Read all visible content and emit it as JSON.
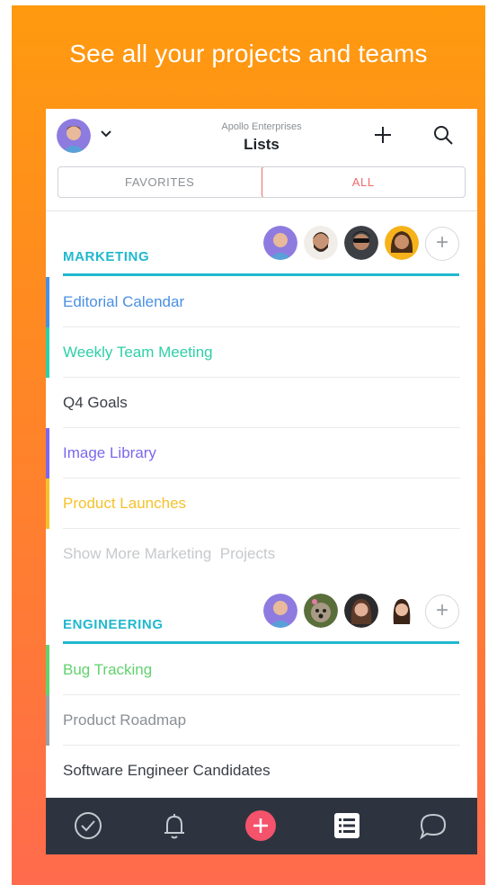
{
  "headline": "See all your projects and teams",
  "header": {
    "org_name": "Apollo Enterprises",
    "title": "Lists",
    "tabs": [
      {
        "label": "FAVORITES",
        "selected": false
      },
      {
        "label": "ALL",
        "selected": true
      }
    ]
  },
  "sections": [
    {
      "title": "MARKETING",
      "members": [
        "avatar-purple",
        "avatar-bearded",
        "avatar-sunglasses",
        "avatar-yellow"
      ],
      "items": [
        {
          "label": "Editorial Calendar",
          "color": "#4a90e2"
        },
        {
          "label": "Weekly Team Meeting",
          "color": "#2ecfa7"
        },
        {
          "label": "Q4 Goals",
          "color": "#3a3f45"
        },
        {
          "label": "Image Library",
          "color": "#7b68ee"
        },
        {
          "label": "Product Launches",
          "color": "#f5c22b"
        }
      ],
      "show_more": "Show More Marketing  Projects"
    },
    {
      "title": "ENGINEERING",
      "members": [
        "avatar-purple",
        "avatar-dog",
        "avatar-brunette",
        "avatar-woman"
      ],
      "items": [
        {
          "label": "Bug Tracking",
          "color": "#62d26f"
        },
        {
          "label": "Product Roadmap",
          "color": "#9aa0a6"
        },
        {
          "label": "Software Engineer Candidates",
          "color": "#3a3f45"
        }
      ]
    }
  ],
  "tabbar": {
    "items": [
      "check-icon",
      "bell-icon",
      "add-icon",
      "list-icon",
      "chat-icon"
    ],
    "accent": "#f4536b"
  },
  "colors": {
    "section_accent": "#21b8ce",
    "segment_selected": "#f06a6a",
    "tabbar_bg": "#2d3440"
  }
}
